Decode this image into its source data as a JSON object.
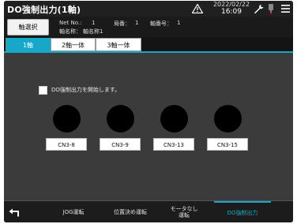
{
  "window": {
    "title": "DO強制出力(1軸)",
    "date": "2022/02/22",
    "time": "16:09"
  },
  "infobar": {
    "axis_select_label": "軸選択",
    "net_no_label": "Net No.:",
    "net_no_value": "1",
    "station_label": "局番：",
    "station_value": "1",
    "axis_no_label": "軸番号：",
    "axis_no_value": "1",
    "axis_name_label": "軸名称：",
    "axis_name_value": "軸名称1"
  },
  "tabs": [
    {
      "label": "1軸",
      "active": true
    },
    {
      "label": "2軸一体",
      "active": false
    },
    {
      "label": "3軸一体",
      "active": false
    }
  ],
  "panel": {
    "checkbox_label": "DO強制出力を開始します。",
    "checkbox_checked": false,
    "outputs": [
      {
        "label": "CN3-8",
        "state": "off"
      },
      {
        "label": "CN3-9",
        "state": "off"
      },
      {
        "label": "CN3-13",
        "state": "off"
      },
      {
        "label": "CN3-15",
        "state": "off"
      }
    ]
  },
  "nav": {
    "items": [
      {
        "label": "JOG運転",
        "active": false
      },
      {
        "label": "位置決め運転",
        "active": false
      },
      {
        "label": "モータなし\n運転",
        "active": false
      },
      {
        "label": "DO強制出力",
        "active": true
      }
    ]
  },
  "colors": {
    "accent": "#17a8c9",
    "background": "#3b3b3b",
    "titlebar": "#202020",
    "lamp_off": "#000000"
  },
  "icons": {
    "warning": "warning-icon",
    "wrench": "wrench-icon",
    "plug": "plug-icon",
    "menu": "menu-icon",
    "back": "back-arrow-icon"
  }
}
